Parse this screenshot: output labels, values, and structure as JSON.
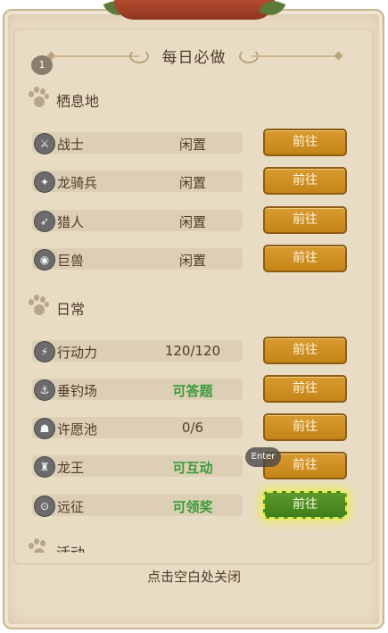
{
  "panel": {
    "title": "每日必做",
    "badge_count": "1",
    "footer": "点击空白处关闭"
  },
  "sections": {
    "habitat": {
      "label": "栖息地",
      "icon": "paw-icon",
      "rows": [
        {
          "name": "战士",
          "icon": "warrior-icon",
          "status": "闲置",
          "status_color": "#4e3d2a",
          "button": "前往"
        },
        {
          "name": "龙骑兵",
          "icon": "dragoon-icon",
          "status": "闲置",
          "status_color": "#4e3d2a",
          "button": "前往"
        },
        {
          "name": "猎人",
          "icon": "hunter-icon",
          "status": "闲置",
          "status_color": "#4e3d2a",
          "button": "前往"
        },
        {
          "name": "巨兽",
          "icon": "behemoth-icon",
          "status": "闲置",
          "status_color": "#4e3d2a",
          "button": "前往"
        }
      ]
    },
    "daily": {
      "label": "日常",
      "icon": "paw-icon",
      "rows": [
        {
          "name": "行动力",
          "icon": "stamina-icon",
          "status": "120/120",
          "status_color": "#4e3d2a",
          "button": "前往"
        },
        {
          "name": "垂钓场",
          "icon": "fishing-icon",
          "status": "可答题",
          "status_color": "#3d9a3a",
          "button": "前往"
        },
        {
          "name": "许愿池",
          "icon": "wishing-well-icon",
          "status": "0/6",
          "status_color": "#4e3d2a",
          "button": "前往"
        },
        {
          "name": "龙王",
          "icon": "dragon-king-icon",
          "status": "可互动",
          "status_color": "#3d9a3a",
          "button": "前往"
        },
        {
          "name": "远征",
          "icon": "expedition-icon",
          "status": "可领奖",
          "status_color": "#3d9a3a",
          "button": "前往"
        }
      ]
    },
    "events": {
      "label": "活动",
      "icon": "paw-icon"
    }
  },
  "overlay": {
    "enter_label": "Enter"
  },
  "colors": {
    "parchment": "#e9dcc4",
    "button_gold": "#d99b30",
    "button_green": "#4a8a22",
    "highlight": "#e8f046",
    "status_green": "#3d9a3a"
  }
}
